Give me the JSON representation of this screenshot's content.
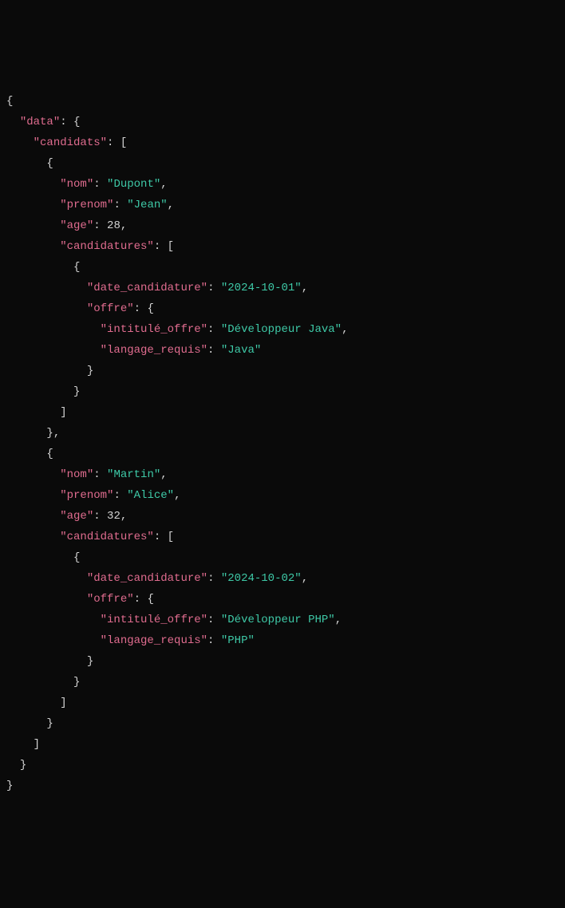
{
  "tokens": [
    [
      {
        "t": "brace",
        "v": "{"
      }
    ],
    [
      {
        "t": "indent",
        "v": "  "
      },
      {
        "t": "key",
        "v": "\"data\""
      },
      {
        "t": "colon",
        "v": ": "
      },
      {
        "t": "brace",
        "v": "{"
      }
    ],
    [
      {
        "t": "indent",
        "v": "    "
      },
      {
        "t": "key",
        "v": "\"candidats\""
      },
      {
        "t": "colon",
        "v": ": "
      },
      {
        "t": "bracket",
        "v": "["
      }
    ],
    [
      {
        "t": "indent",
        "v": "      "
      },
      {
        "t": "brace",
        "v": "{"
      }
    ],
    [
      {
        "t": "indent",
        "v": "        "
      },
      {
        "t": "key",
        "v": "\"nom\""
      },
      {
        "t": "colon",
        "v": ": "
      },
      {
        "t": "string",
        "v": "\"Dupont\""
      },
      {
        "t": "comma",
        "v": ","
      }
    ],
    [
      {
        "t": "indent",
        "v": "        "
      },
      {
        "t": "key",
        "v": "\"prenom\""
      },
      {
        "t": "colon",
        "v": ": "
      },
      {
        "t": "string",
        "v": "\"Jean\""
      },
      {
        "t": "comma",
        "v": ","
      }
    ],
    [
      {
        "t": "indent",
        "v": "        "
      },
      {
        "t": "key",
        "v": "\"age\""
      },
      {
        "t": "colon",
        "v": ": "
      },
      {
        "t": "number",
        "v": "28"
      },
      {
        "t": "comma",
        "v": ","
      }
    ],
    [
      {
        "t": "indent",
        "v": "        "
      },
      {
        "t": "key",
        "v": "\"candidatures\""
      },
      {
        "t": "colon",
        "v": ": "
      },
      {
        "t": "bracket",
        "v": "["
      }
    ],
    [
      {
        "t": "indent",
        "v": "          "
      },
      {
        "t": "brace",
        "v": "{"
      }
    ],
    [
      {
        "t": "indent",
        "v": "            "
      },
      {
        "t": "key",
        "v": "\"date_candidature\""
      },
      {
        "t": "colon",
        "v": ": "
      },
      {
        "t": "string",
        "v": "\"2024-10-01\""
      },
      {
        "t": "comma",
        "v": ","
      }
    ],
    [
      {
        "t": "indent",
        "v": "            "
      },
      {
        "t": "key",
        "v": "\"offre\""
      },
      {
        "t": "colon",
        "v": ": "
      },
      {
        "t": "brace",
        "v": "{"
      }
    ],
    [
      {
        "t": "indent",
        "v": "              "
      },
      {
        "t": "key",
        "v": "\"intitulé_offre\""
      },
      {
        "t": "colon",
        "v": ": "
      },
      {
        "t": "string",
        "v": "\"Développeur Java\""
      },
      {
        "t": "comma",
        "v": ","
      }
    ],
    [
      {
        "t": "indent",
        "v": "              "
      },
      {
        "t": "key",
        "v": "\"langage_requis\""
      },
      {
        "t": "colon",
        "v": ": "
      },
      {
        "t": "string",
        "v": "\"Java\""
      }
    ],
    [
      {
        "t": "indent",
        "v": "            "
      },
      {
        "t": "brace",
        "v": "}"
      }
    ],
    [
      {
        "t": "indent",
        "v": "          "
      },
      {
        "t": "brace",
        "v": "}"
      }
    ],
    [
      {
        "t": "indent",
        "v": "        "
      },
      {
        "t": "bracket",
        "v": "]"
      }
    ],
    [
      {
        "t": "indent",
        "v": "      "
      },
      {
        "t": "brace",
        "v": "}"
      },
      {
        "t": "comma",
        "v": ","
      }
    ],
    [
      {
        "t": "indent",
        "v": "      "
      },
      {
        "t": "brace",
        "v": "{"
      }
    ],
    [
      {
        "t": "indent",
        "v": "        "
      },
      {
        "t": "key",
        "v": "\"nom\""
      },
      {
        "t": "colon",
        "v": ": "
      },
      {
        "t": "string",
        "v": "\"Martin\""
      },
      {
        "t": "comma",
        "v": ","
      }
    ],
    [
      {
        "t": "indent",
        "v": "        "
      },
      {
        "t": "key",
        "v": "\"prenom\""
      },
      {
        "t": "colon",
        "v": ": "
      },
      {
        "t": "string",
        "v": "\"Alice\""
      },
      {
        "t": "comma",
        "v": ","
      }
    ],
    [
      {
        "t": "indent",
        "v": "        "
      },
      {
        "t": "key",
        "v": "\"age\""
      },
      {
        "t": "colon",
        "v": ": "
      },
      {
        "t": "number",
        "v": "32"
      },
      {
        "t": "comma",
        "v": ","
      }
    ],
    [
      {
        "t": "indent",
        "v": "        "
      },
      {
        "t": "key",
        "v": "\"candidatures\""
      },
      {
        "t": "colon",
        "v": ": "
      },
      {
        "t": "bracket",
        "v": "["
      }
    ],
    [
      {
        "t": "indent",
        "v": "          "
      },
      {
        "t": "brace",
        "v": "{"
      }
    ],
    [
      {
        "t": "indent",
        "v": "            "
      },
      {
        "t": "key",
        "v": "\"date_candidature\""
      },
      {
        "t": "colon",
        "v": ": "
      },
      {
        "t": "string",
        "v": "\"2024-10-02\""
      },
      {
        "t": "comma",
        "v": ","
      }
    ],
    [
      {
        "t": "indent",
        "v": "            "
      },
      {
        "t": "key",
        "v": "\"offre\""
      },
      {
        "t": "colon",
        "v": ": "
      },
      {
        "t": "brace",
        "v": "{"
      }
    ],
    [
      {
        "t": "indent",
        "v": "              "
      },
      {
        "t": "key",
        "v": "\"intitulé_offre\""
      },
      {
        "t": "colon",
        "v": ": "
      },
      {
        "t": "string",
        "v": "\"Développeur PHP\""
      },
      {
        "t": "comma",
        "v": ","
      }
    ],
    [
      {
        "t": "indent",
        "v": "              "
      },
      {
        "t": "key",
        "v": "\"langage_requis\""
      },
      {
        "t": "colon",
        "v": ": "
      },
      {
        "t": "string",
        "v": "\"PHP\""
      }
    ],
    [
      {
        "t": "indent",
        "v": "            "
      },
      {
        "t": "brace",
        "v": "}"
      }
    ],
    [
      {
        "t": "indent",
        "v": "          "
      },
      {
        "t": "brace",
        "v": "}"
      }
    ],
    [
      {
        "t": "indent",
        "v": "        "
      },
      {
        "t": "bracket",
        "v": "]"
      }
    ],
    [
      {
        "t": "indent",
        "v": "      "
      },
      {
        "t": "brace",
        "v": "}"
      }
    ],
    [
      {
        "t": "indent",
        "v": "    "
      },
      {
        "t": "bracket",
        "v": "]"
      }
    ],
    [
      {
        "t": "indent",
        "v": "  "
      },
      {
        "t": "brace",
        "v": "}"
      }
    ],
    [
      {
        "t": "brace",
        "v": "}"
      }
    ]
  ]
}
